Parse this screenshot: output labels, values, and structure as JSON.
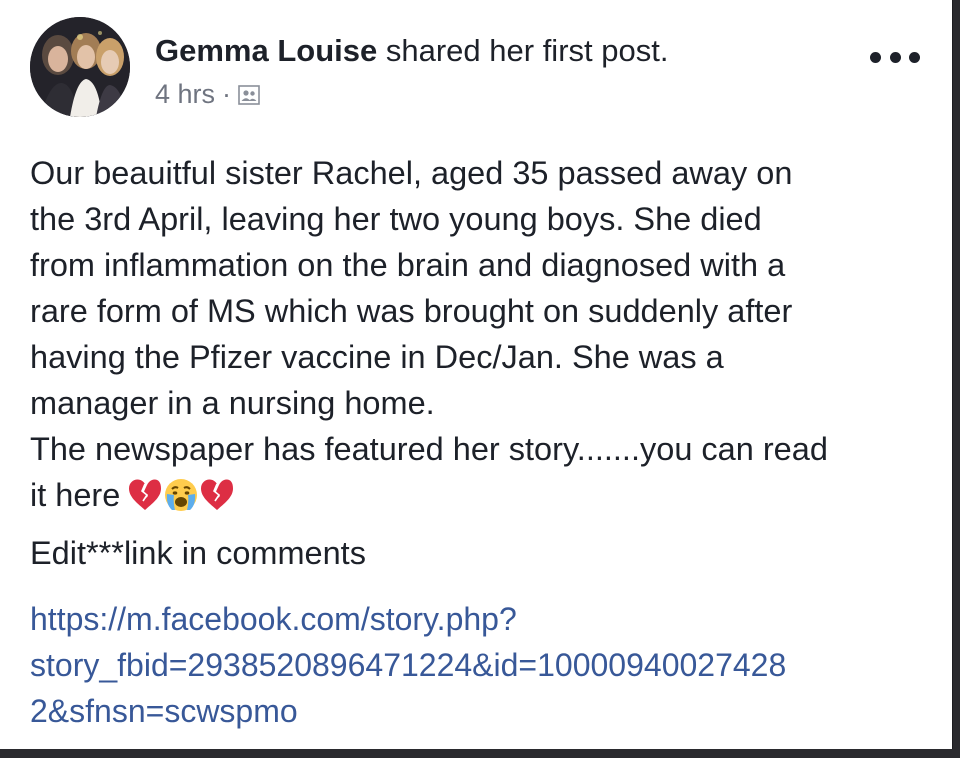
{
  "post": {
    "author": "Gemma Louise",
    "action": "shared her first post.",
    "timestamp": "4 hrs",
    "separator": "·",
    "audience_icon": "friends-icon",
    "more_icon": "more-options-icon",
    "body_lines": [
      "Our beauitful sister Rachel, aged 35 passed away on",
      "the 3rd April, leaving her two young boys. She died",
      "from inflammation on the brain and diagnosed with a",
      "rare form of MS which was brought on suddenly after",
      "having the Pfizer vaccine in Dec/Jan. She was a",
      "manager in a nursing home.",
      "The newspaper has featured her story.......you can read",
      "it here"
    ],
    "emojis": [
      "broken-heart-icon",
      "crying-face-icon",
      "broken-heart-icon"
    ],
    "edit_note": "Edit***link in comments",
    "link_lines": [
      "https://m.facebook.com/story.php?",
      "story_fbid=2938520896471224&id=10000940027428",
      "2&sfnsn=scwspmo"
    ]
  },
  "colors": {
    "text": "#1d2129",
    "meta": "#6f7480",
    "link": "#385898",
    "background": "#ffffff"
  }
}
